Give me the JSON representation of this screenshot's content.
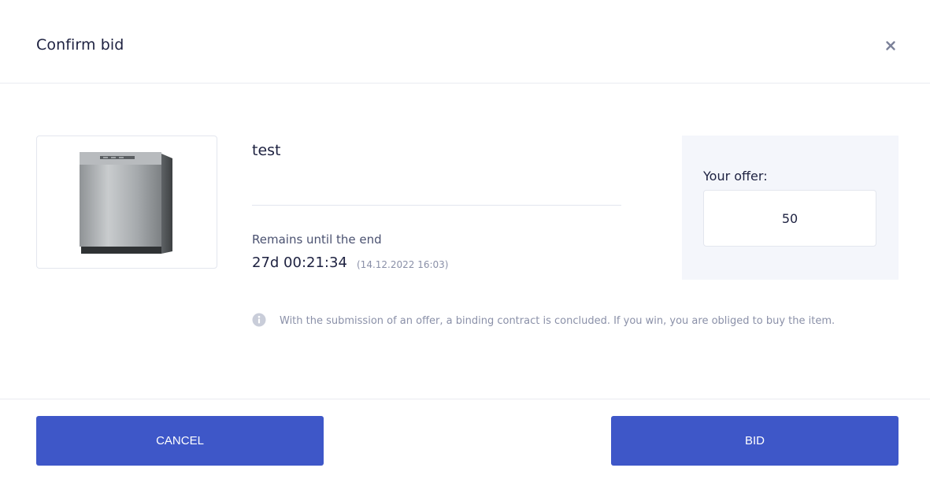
{
  "dialog": {
    "title": "Confirm bid",
    "close_icon": "close-icon"
  },
  "item": {
    "name": "test",
    "image_icon": "dishwasher-image",
    "remains_label": "Remains until the end",
    "countdown": "27d 00:21:34",
    "end_date": "(14.12.2022 16:03)"
  },
  "offer": {
    "label": "Your offer:",
    "value": "50"
  },
  "notice": {
    "icon": "info-icon",
    "text": "With the submission of an offer, a binding contract is concluded. If you win, you are obliged to buy the item."
  },
  "buttons": {
    "cancel": "CANCEL",
    "bid": "BID"
  },
  "colors": {
    "primary": "#3e57c8",
    "panel_bg": "#f4f6fb"
  }
}
